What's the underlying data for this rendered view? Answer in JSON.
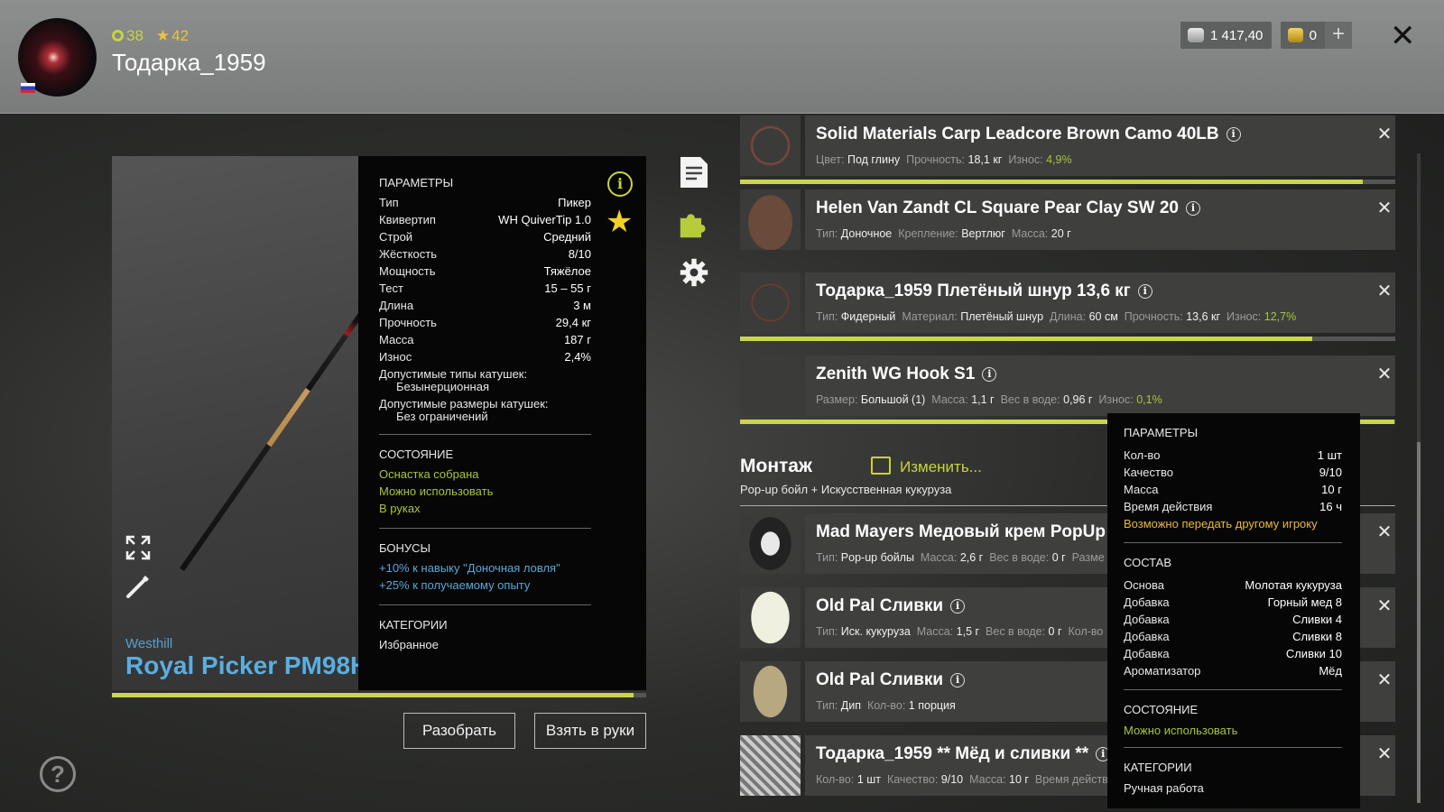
{
  "header": {
    "level": "38",
    "rating": "42",
    "username": "Тодарка_1959",
    "silver": "1 417,40",
    "gold": "0",
    "plus": "+",
    "close": "✕"
  },
  "rod": {
    "brand": "Westhill",
    "name": "Royal Picker PM98H",
    "durability_fraction": 0.976,
    "params_title": "ПАРАМЕТРЫ",
    "params": [
      {
        "label": "Тип",
        "value": "Пикер"
      },
      {
        "label": "Квивертип",
        "value": "WH QuiverTip 1.0"
      },
      {
        "label": "Строй",
        "value": "Средний"
      },
      {
        "label": "Жёсткость",
        "value": "8/10"
      },
      {
        "label": "Мощность",
        "value": "Тяжёлое"
      },
      {
        "label": "Тест",
        "value": "15 – 55 г"
      },
      {
        "label": "Длина",
        "value": "3 м"
      },
      {
        "label": "Прочность",
        "value": "29,4 кг"
      },
      {
        "label": "Масса",
        "value": "187 г"
      },
      {
        "label": "Износ",
        "value": "2,4%"
      }
    ],
    "reel_types_label": "Допустимые типы катушек:",
    "reel_types_value": "Безынерционная",
    "reel_sizes_label": "Допустимые размеры катушек:",
    "reel_sizes_value": "Без ограничений",
    "state_title": "СОСТОЯНИЕ",
    "states": [
      "Оснастка собрана",
      "Можно использовать",
      "В руках"
    ],
    "bonus_title": "БОНУСЫ",
    "bonuses": [
      "+10% к навыку \"Доночная ловля\"",
      "+25% к получаемому опыту"
    ],
    "cat_title": "КАТЕГОРИИ",
    "category": "Избранное",
    "info_icon": "info-icon",
    "fav_icon": "star-icon"
  },
  "buttons": {
    "disassemble": "Разобрать",
    "take": "Взять в руки"
  },
  "items": [
    {
      "title": "Solid Materials Carp Leadcore Brown Camo 40LB",
      "meta": [
        [
          "Цвет:",
          "Под глину"
        ],
        [
          "Прочность:",
          "18,1 кг"
        ],
        [
          "Износ:",
          "4,9%"
        ]
      ],
      "wear_fraction": 0.951
    },
    {
      "title": "Helen Van Zandt CL Square Pear Clay SW 20",
      "meta": [
        [
          "Тип:",
          "Доночное"
        ],
        [
          "Крепление:",
          "Вертлюг"
        ],
        [
          "Масса:",
          "20 г"
        ]
      ]
    },
    {
      "title": "Тодарка_1959 Плетёный шнур 13,6 кг",
      "meta": [
        [
          "Тип:",
          "Фидерный"
        ],
        [
          "Материал:",
          "Плетёный шнур"
        ],
        [
          "Длина:",
          "60 см"
        ],
        [
          "Прочность:",
          "13,6 кг"
        ],
        [
          "Износ:",
          "12,7%"
        ]
      ],
      "wear_fraction": 0.873
    },
    {
      "title": "Zenith WG Hook S1",
      "meta": [
        [
          "Размер:",
          "Большой (1)"
        ],
        [
          "Масса:",
          "1,1 г"
        ],
        [
          "Вес в воде:",
          "0,96 г"
        ],
        [
          "Износ:",
          "0,1%"
        ]
      ],
      "wear_fraction": 0.999
    },
    {
      "title": "Mad Mayers Медовый крем PopUp 1",
      "meta": [
        [
          "Тип:",
          "Pop-up бойлы"
        ],
        [
          "Масса:",
          "2,6 г"
        ],
        [
          "Вес в воде:",
          "0 г"
        ],
        [
          "Разме",
          ""
        ]
      ]
    },
    {
      "title": "Old Pal Сливки",
      "meta": [
        [
          "Тип:",
          "Иск. кукуруза"
        ],
        [
          "Масса:",
          "1,5 г"
        ],
        [
          "Вес в воде:",
          "0 г"
        ],
        [
          "Кол-во",
          ""
        ]
      ]
    },
    {
      "title": "Old Pal Сливки",
      "meta": [
        [
          "Тип:",
          "Дип"
        ],
        [
          "Кол-во:",
          "1 порция"
        ]
      ]
    },
    {
      "title": "Тодарка_1959 ** Мёд и сливки **",
      "meta": [
        [
          "Кол-во:",
          "1 шт"
        ],
        [
          "Качество:",
          "9/10"
        ],
        [
          "Масса:",
          "10 г"
        ],
        [
          "Время действ",
          ""
        ]
      ]
    }
  ],
  "montage": {
    "title": "Монтаж",
    "edit": "Изменить...",
    "subtitle": "Pop-up бойл  +  Искусственная кукуруза"
  },
  "tooltip": {
    "params_title": "ПАРАМЕТРЫ",
    "params": [
      {
        "label": "Кол-во",
        "value": "1 шт"
      },
      {
        "label": "Качество",
        "value": "9/10"
      },
      {
        "label": "Масса",
        "value": "10 г"
      },
      {
        "label": "Время действия",
        "value": "16 ч"
      }
    ],
    "transfer": "Возможно передать другому игроку",
    "comp_title": "СОСТАВ",
    "composition": [
      {
        "label": "Основа",
        "value": "Молотая кукуруза"
      },
      {
        "label": "Добавка",
        "value": "Горный мед 8"
      },
      {
        "label": "Добавка",
        "value": "Сливки 4"
      },
      {
        "label": "Добавка",
        "value": "Сливки 8"
      },
      {
        "label": "Добавка",
        "value": "Сливки 10"
      },
      {
        "label": "Ароматизатор",
        "value": "Мёд"
      }
    ],
    "state_title": "СОСТОЯНИЕ",
    "state": "Можно использовать",
    "cat_title": "КАТЕГОРИИ",
    "category": "Ручная работа"
  },
  "help": "?",
  "colors": {
    "accent": "#c9d64b",
    "blue": "#5aaee0",
    "gold": "#e9c43a"
  }
}
